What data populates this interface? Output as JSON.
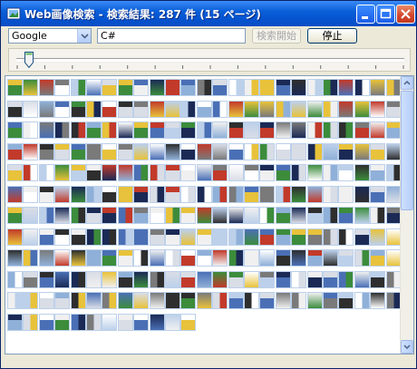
{
  "window": {
    "title": "Web画像検索 - 検索結果: 287 件 (15 ページ)"
  },
  "search": {
    "engine": "Google",
    "query": "C#",
    "start_label": "検索開始",
    "stop_label": "停止"
  },
  "page_slider": {
    "value": 1,
    "min": 1,
    "max": 15
  },
  "results": {
    "thumbnail_count": 287,
    "columns": 25,
    "palette": [
      "#ffffff",
      "#d9dde6",
      "#4a6fb5",
      "#1b2a55",
      "#c23a2a",
      "#e8c23a",
      "#3c8c3c",
      "#7a7a7a",
      "#bcd0ea",
      "#2e2e2e",
      "#8fb0d8",
      "#f0f0f0"
    ]
  }
}
